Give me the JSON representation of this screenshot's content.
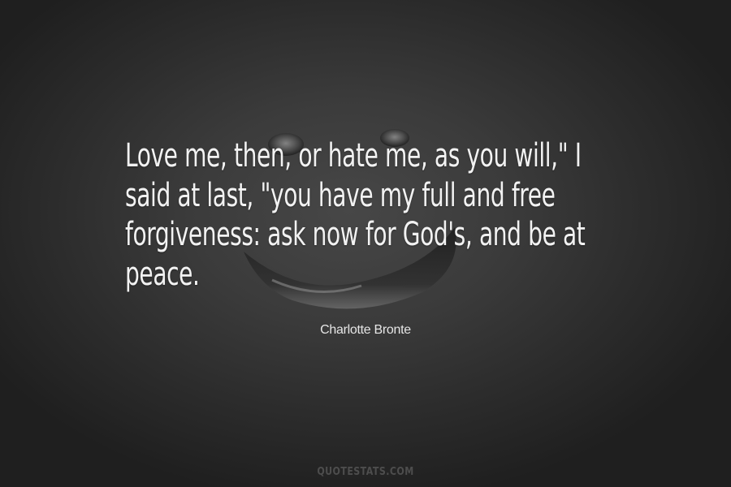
{
  "quote": {
    "lines": [
      "Love me, then, or hate me, as you will,\" I",
      "said at last, \"you have my full and free",
      "forgiveness: ask now for God's, and be at",
      "peace."
    ]
  },
  "author": "Charlotte Bronte",
  "watermark": "QUOTESTATS.COM",
  "colors": {
    "background": "#2a2a2a",
    "text": "#f2f2f2"
  }
}
